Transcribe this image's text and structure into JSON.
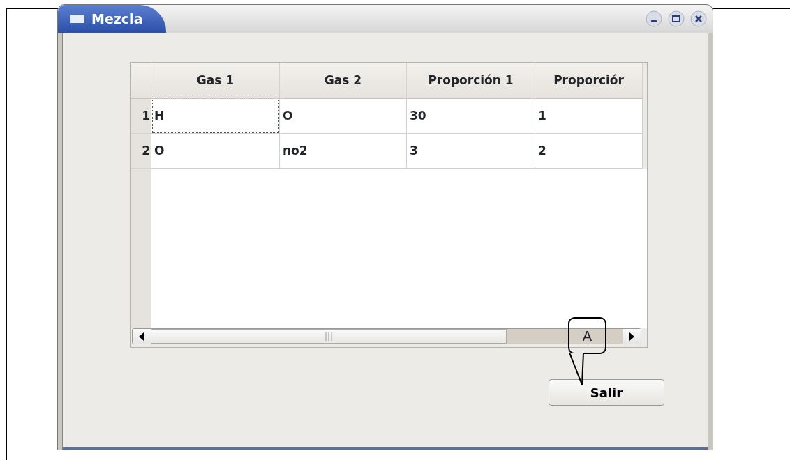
{
  "window": {
    "title": "Mezcla"
  },
  "table": {
    "columns": [
      "Gas 1",
      "Gas 2",
      "Proporción 1",
      "Proporciór"
    ],
    "rows": [
      {
        "header": "1",
        "cells": [
          {
            "text": "H",
            "focused": true
          },
          {
            "text": "O",
            "focused": false
          },
          {
            "text": "30",
            "focused": false
          },
          {
            "text": "1",
            "focused": false
          }
        ]
      },
      {
        "header": "2",
        "cells": [
          {
            "text": "O",
            "focused": false
          },
          {
            "text": "no2",
            "focused": false
          },
          {
            "text": "3",
            "focused": false
          },
          {
            "text": "2",
            "focused": false
          }
        ]
      }
    ]
  },
  "buttons": [
    "Salir"
  ],
  "callout": {
    "label": "A"
  }
}
